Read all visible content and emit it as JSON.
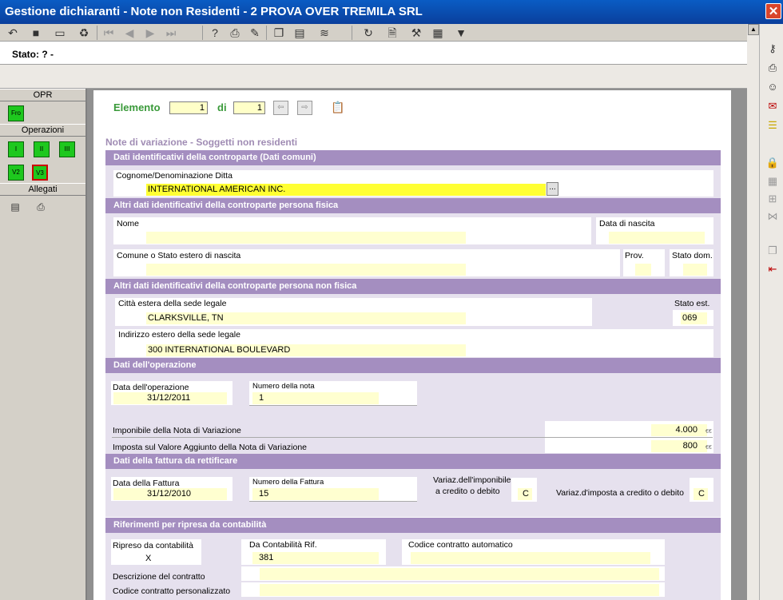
{
  "window": {
    "title": "Gestione dichiaranti -  Note non Residenti - 2 PROVA OVER TREMILA SRL",
    "close_glyph": "✕"
  },
  "toolbar": {
    "icons": [
      "undo-icon",
      "save-icon",
      "preview-icon",
      "delete-icon",
      "first-icon",
      "prev-icon",
      "next-icon",
      "last-icon",
      "help-icon",
      "print-icon",
      "report-icon",
      "copy-icon",
      "paste-icon",
      "stack-icon",
      "refresh-icon",
      "doc-icon",
      "tools-icon",
      "calculator-icon",
      "dropdown-icon"
    ]
  },
  "status": {
    "text": "Stato: ? -"
  },
  "left_panel": {
    "opr_header": "OPR",
    "fro_label": "Fro",
    "operazioni_header": "Operazioni",
    "op_buttons": [
      "I",
      "II",
      "III"
    ],
    "v_buttons": [
      "V2",
      "V3"
    ],
    "allegati_header": "Allegati"
  },
  "nav": {
    "elemento_label": "Elemento",
    "elemento_value": "1",
    "di_label": "di",
    "total_value": "1",
    "prev_glyph": "⇦",
    "next_glyph": "⇨"
  },
  "form": {
    "title": "Note di variazione - Soggetti non residenti",
    "sec1": {
      "header": "Dati identificativi della controparte (Dati comuni)",
      "cognome_label": "Cognome/Denominazione Ditta",
      "cognome_value": "INTERNATIONAL AMERICAN INC.",
      "lookup_label": "..."
    },
    "sec2": {
      "header": "Altri dati identificativi della controparte persona fisica",
      "nome_label": "Nome",
      "nome_value": "",
      "nascita_label": "Data di nascita",
      "nascita_value": "",
      "comune_label": "Comune o Stato estero di nascita",
      "comune_value": "",
      "prov_label": "Prov.",
      "prov_value": "",
      "statodom_label": "Stato dom.",
      "statodom_value": ""
    },
    "sec3": {
      "header": "Altri dati identificativi della controparte persona non fisica",
      "citta_label": "Città estera della sede legale",
      "citta_value": "CLARKSVILLE, TN",
      "statoest_label": "Stato est.",
      "statoest_value": "069",
      "indirizzo_label": "Indirizzo estero della sede legale",
      "indirizzo_value": "300 INTERNATIONAL BOULEVARD"
    },
    "sec4": {
      "header": "Dati dell'operazione",
      "dataop_label": "Data dell'operazione",
      "dataop_value": "31/12/2011",
      "numnota_label": "Numero della nota",
      "numnota_value": "1",
      "imponibile_label": "Imponibile della Nota di Variazione",
      "imponibile_value": "4.000",
      "imposta_label": "Imposta sul Valore Aggiunto della Nota di Variazione",
      "imposta_value": "800",
      "currency": "€€"
    },
    "sec5": {
      "header": "Dati della fattura da rettificare",
      "datafatt_label": "Data della Fattura",
      "datafatt_value": "31/12/2010",
      "numfatt_label": "Numero della Fattura",
      "numfatt_value": "15",
      "variaz_imp_label_1": "Variaz.dell'imponibile",
      "variaz_imp_label_2": "a credito o debito",
      "variaz_imp_value": "C",
      "variaz_iva_label": "Variaz.d'imposta a credito o debito",
      "variaz_iva_value": "C"
    },
    "sec6": {
      "header": "Riferimenti per ripresa da contabilità",
      "ripreso_label": "Ripreso da contabilità",
      "ripreso_value": "X",
      "darif_label": "Da Contabilità Rif.",
      "darif_value": "381",
      "codauto_label": "Codice contratto automatico",
      "codauto_value": "",
      "descr_label": "Descrizione del contratto",
      "descr_value": "",
      "codpers_label": "Codice contratto personalizzato",
      "codpers_value": ""
    }
  },
  "colors": {
    "title_bar": "#0a4fb4",
    "section_header": "#a48ec0",
    "section_bg": "#e6e1ee",
    "field_bg": "#ffffd0",
    "active_field": "#ffff33",
    "green_label": "#3a9a3a",
    "op_button": "#1ec81e"
  }
}
